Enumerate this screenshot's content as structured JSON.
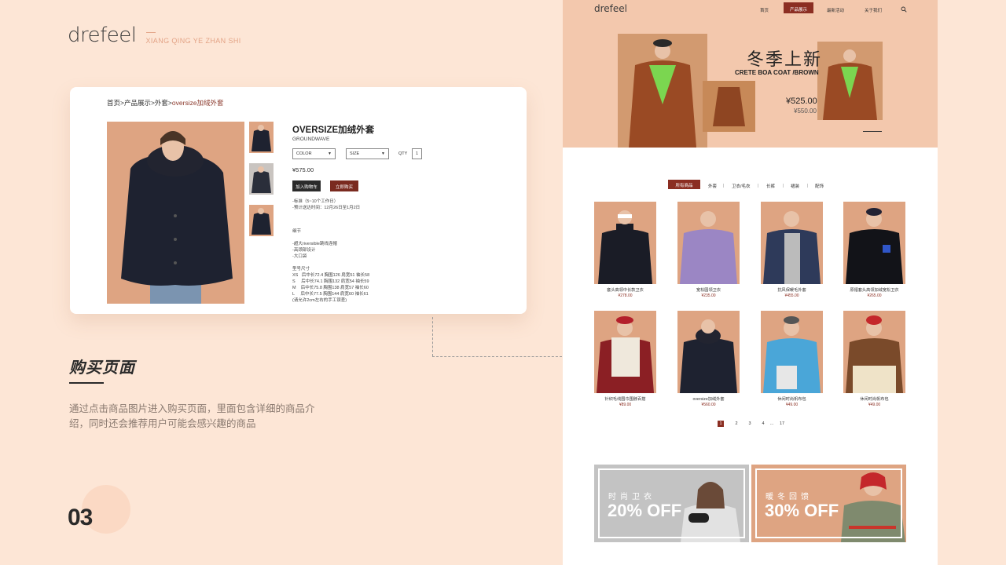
{
  "brand": {
    "logo": "drefeel",
    "subtitle": "XIANG QING YE ZHAN SHI"
  },
  "detail": {
    "breadcrumb_prefix": "首页>产品展示>外套>",
    "breadcrumb_current": "oversize加绒外套",
    "title": "OVERSIZE加绒外套",
    "brand": "GROUNDWAVE",
    "color_label": "COLOR",
    "size_label": "SIZE",
    "qty_label": "QTY",
    "qty_value": "1",
    "price": "¥575.00",
    "add_to_cart": "加入购物车",
    "buy_now": "立即购买",
    "shipping": "-标准（5~10个工作日）\n-预计送达时间：12月26日至1月2日",
    "details_heading": "细节",
    "details": "-超大riversible跳线连帽\n-高颈部设计\n-大口袋",
    "size_heading": "型号尺寸",
    "sizes": "XS   后中长72.4 胸围126 肩宽51 袖长58\nS     后中长74.1 胸围132 肩宽54 袖长59\nM    后中长75.8 胸围138 肩宽57 袖长60\nL     后中长77.5 胸围144 肩宽60 袖长61\n(请允许2cm左右的手工误差)"
  },
  "section": {
    "title": "购买页面",
    "description": "通过点击商品图片进入购买页面，里面包含详细的商品介绍，同时还会推荐用户可能会感兴趣的商品",
    "number": "03"
  },
  "site": {
    "logo": "drefeel",
    "nav": [
      "首页",
      "产品展示",
      "最新活动",
      "关于我们"
    ],
    "hero": {
      "title": "冬季上新",
      "subtitle": "CRETE BOA COAT /BROWN",
      "price": "¥525.00",
      "old_price": "¥550.00"
    },
    "filters": [
      "所有商品",
      "外套",
      "卫衣/毛衣",
      "长裤",
      "裙装",
      "配饰"
    ],
    "products": [
      {
        "name": "套头高领中长款卫衣",
        "price": "¥278.00"
      },
      {
        "name": "宽松圆领卫衣",
        "price": "¥235.00"
      },
      {
        "name": "抗风保暖毛外套",
        "price": "¥455.00"
      },
      {
        "name": "原褶套头高领加绒宽松卫衣",
        "price": "¥265.00"
      },
      {
        "name": "针织毛线围巾围脖百搭",
        "price": "¥89.00"
      },
      {
        "name": "oversize加绒外套",
        "price": "¥560.00"
      },
      {
        "name": "休闲时尚帆布包",
        "price": "¥49.00"
      },
      {
        "name": "休闲时尚帆布包",
        "price": "¥49.00"
      }
    ],
    "pagination": [
      "1",
      "2",
      "3",
      "4",
      "...",
      "17"
    ],
    "promos": [
      {
        "small": "时尚卫衣",
        "big": "20% OFF"
      },
      {
        "small": "暖冬回馈",
        "big": "30% OFF"
      }
    ]
  },
  "colors": {
    "accent": "#8b2e22",
    "background": "#fde6d6",
    "product_bg": "#dea482"
  }
}
